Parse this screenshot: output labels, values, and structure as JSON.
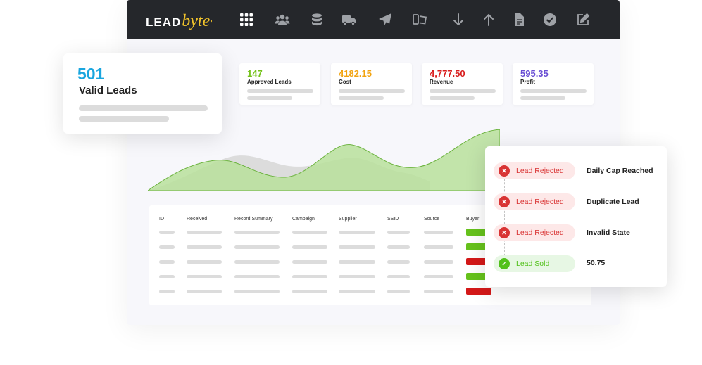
{
  "brand": {
    "lead": "LEAD",
    "byte": "byte"
  },
  "nav_icons": [
    "apps-grid-icon",
    "users-icon",
    "database-icon",
    "truck-icon",
    "send-icon",
    "device-icon",
    "arrow-down-icon",
    "arrow-up-icon",
    "document-icon",
    "check-circle-icon",
    "edit-icon"
  ],
  "valid_leads": {
    "value": "501",
    "label": "Valid Leads"
  },
  "stats": [
    {
      "value": "147",
      "label": "Approved Leads",
      "color": "#74c21a"
    },
    {
      "value": "4182.15",
      "label": "Cost",
      "color": "#f2a30f"
    },
    {
      "value": "4,777.50",
      "label": "Revenue",
      "color": "#d91e1e"
    },
    {
      "value": "595.35",
      "label": "Profit",
      "color": "#6a4fd4"
    }
  ],
  "table": {
    "columns": [
      "ID",
      "Received",
      "Record Summary",
      "Campaign",
      "Supplier",
      "SSID",
      "Source",
      "Buyer"
    ],
    "row_status": [
      "green",
      "green",
      "red",
      "green",
      "red"
    ]
  },
  "events": [
    {
      "status": "Lead Rejected",
      "type": "rejected",
      "reason": "Daily Cap Reached"
    },
    {
      "status": "Lead Rejected",
      "type": "rejected",
      "reason": "Duplicate Lead"
    },
    {
      "status": "Lead Rejected",
      "type": "rejected",
      "reason": "Invalid State"
    },
    {
      "status": "Lead Sold",
      "type": "sold",
      "reason": "50.75"
    }
  ],
  "colors": {
    "topbar": "#25272b",
    "accent_blue": "#1aa6df",
    "chart_green": "#8bc34a",
    "reject_red": "#d93434",
    "sold_green": "#52c11b"
  }
}
